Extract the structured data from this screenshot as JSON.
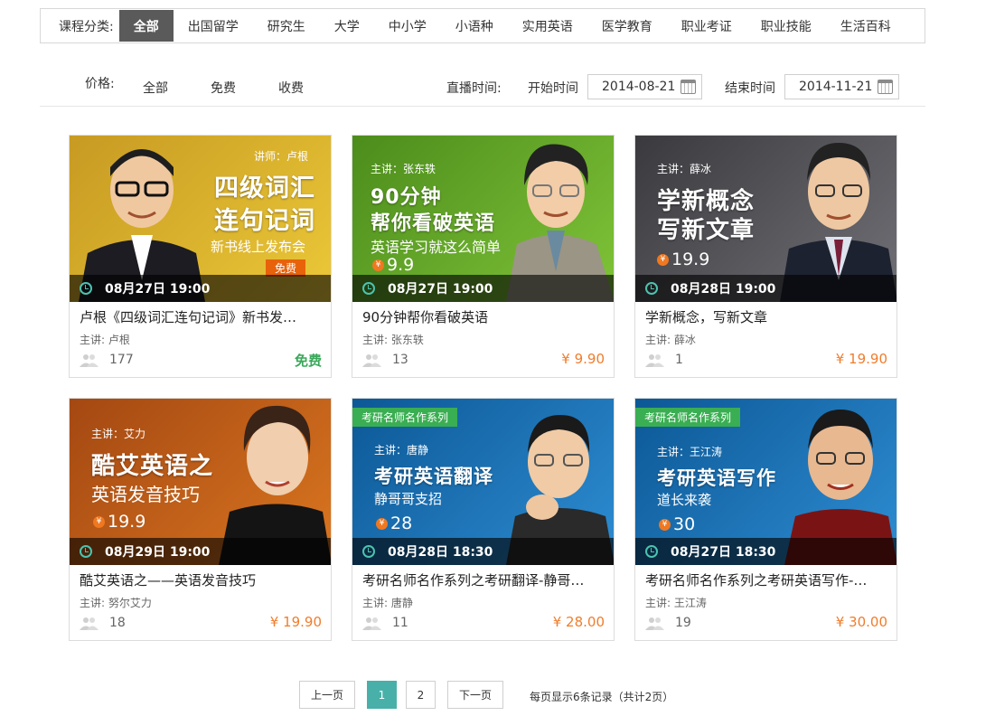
{
  "category_bar": {
    "label": "课程分类:",
    "items": [
      "全部",
      "出国留学",
      "研究生",
      "大学",
      "中小学",
      "小语种",
      "实用英语",
      "医学教育",
      "职业考证",
      "职业技能",
      "生活百科"
    ],
    "active_index": 0
  },
  "filter": {
    "price_label": "价格:",
    "price_options": [
      "全部",
      "免费",
      "收费"
    ],
    "live_time_label": "直播时间:",
    "start_label": "开始时间",
    "start_date": "2014-08-21",
    "end_label": "结束时间",
    "end_date": "2014-11-21"
  },
  "courses": [
    {
      "thumb_speaker": "讲师：卢根",
      "thumb_title_1": "四级词汇",
      "thumb_title_2": "连句记词",
      "thumb_sub": "新书线上发布会",
      "thumb_badge": "免费",
      "time": "08月27日 19:00",
      "title": "卢根《四级词汇连句记词》新书发…",
      "teacher": "主讲: 卢根",
      "count": "177",
      "price": "免费",
      "bg": [
        "#c7a12a",
        "#e9c535"
      ]
    },
    {
      "thumb_speaker": "主讲：张东轶",
      "thumb_title_1": "90分钟",
      "thumb_title_2": "帮你看破英语",
      "thumb_sub": "英语学习就这么简单",
      "thumb_price": "9.9",
      "time": "08月27日 19:00",
      "title": "90分钟帮你看破英语",
      "teacher": "主讲: 张东轶",
      "count": "13",
      "price": "¥ 9.90",
      "bg": [
        "#4e8e1e",
        "#7cc136"
      ]
    },
    {
      "thumb_speaker": "主讲：薛冰",
      "thumb_title_1": "学新概念",
      "thumb_title_2": "写新文章",
      "thumb_price": "19.9",
      "time": "08月28日 19:00",
      "title": "学新概念，写新文章",
      "teacher": "主讲: 薛冰",
      "count": "1",
      "price": "¥ 19.90",
      "bg": [
        "#3a3a3e",
        "#6c6c72"
      ]
    },
    {
      "thumb_speaker": "主讲：艾力",
      "thumb_title_1": "酷艾英语之",
      "thumb_sub": "英语发音技巧",
      "thumb_price": "19.9",
      "time": "08月29日 19:00",
      "title": "酷艾英语之——英语发音技巧",
      "teacher": "主讲: 努尔艾力",
      "count": "18",
      "price": "¥ 19.90",
      "bg": [
        "#a84a14",
        "#d8731e"
      ]
    },
    {
      "thumb_series": "考研名师名作系列",
      "thumb_speaker": "主讲：唐静",
      "thumb_title_1": "考研英语翻译",
      "thumb_sub": "静哥哥支招",
      "thumb_price": "28",
      "time": "08月28日 18:30",
      "title": "考研名师名作系列之考研翻译-静哥…",
      "teacher": "主讲: 唐静",
      "count": "11",
      "price": "¥ 28.00",
      "bg": [
        "#0d5a98",
        "#2c8ad0"
      ]
    },
    {
      "thumb_series": "考研名师名作系列",
      "thumb_speaker": "主讲：王江涛",
      "thumb_title_1": "考研英语写作",
      "thumb_sub": "道长来袭",
      "thumb_price": "30",
      "time": "08月27日 18:30",
      "title": "考研名师名作系列之考研英语写作-…",
      "teacher": "主讲: 王江涛",
      "count": "19",
      "price": "¥ 30.00",
      "bg": [
        "#0d5a98",
        "#2c8ad0"
      ]
    }
  ],
  "pagination": {
    "prev": "上一页",
    "pages": [
      "1",
      "2"
    ],
    "current": "1",
    "next": "下一页",
    "info": "每页显示6条记录（共计2页）"
  },
  "colors": {
    "accent_teal": "#48b0a8",
    "price_orange": "#f07d2c",
    "free_green": "#3aa85a",
    "active_tab_bg": "#5a5a5a"
  }
}
